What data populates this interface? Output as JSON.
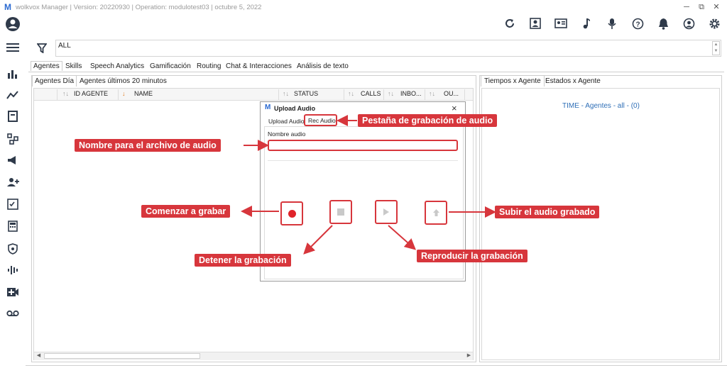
{
  "window": {
    "title": "wolkvox Manager  |  Version: 20220930  |  Operation: modulotest03  |  octubre 5, 2022",
    "logo": "M",
    "minimize": "─",
    "restore": "⧉",
    "close": "✕"
  },
  "filter": {
    "value": "ALL"
  },
  "main_tabs": [
    "Agentes",
    "Skills",
    "Speech Analytics",
    "Gamificación",
    "Routing",
    "Chat & Interacciones",
    "Análisis de texto"
  ],
  "left_panel": {
    "tabs": [
      "Agentes Día",
      "Agentes últimos 20 minutos"
    ],
    "columns": [
      "ID AGENTE",
      "NAME",
      "STATUS",
      "CALLS",
      "INBO...",
      "OU..."
    ]
  },
  "right_panel": {
    "tabs": [
      "Tiempos x Agente",
      "Estados x Agente"
    ],
    "summary": "TIME - Agentes - all -  (0)"
  },
  "dialog": {
    "logo": "M",
    "title": "Upload Audio",
    "close": "×",
    "tabs": [
      "Upload Audio",
      "Rec Audio"
    ],
    "field_label": "Nombre audio",
    "field_value": ""
  },
  "annotations": {
    "rec_tab": "Pestaña de grabación de audio",
    "name_field": "Nombre para el archivo de audio",
    "start": "Comenzar a grabar",
    "upload": "Subir el audio grabado",
    "stop": "Detener la grabación",
    "play": "Reproducir la grabación"
  },
  "colors": {
    "accent_red": "#d7363c",
    "link_blue": "#2f6fb7",
    "record_red": "#e0242a"
  }
}
